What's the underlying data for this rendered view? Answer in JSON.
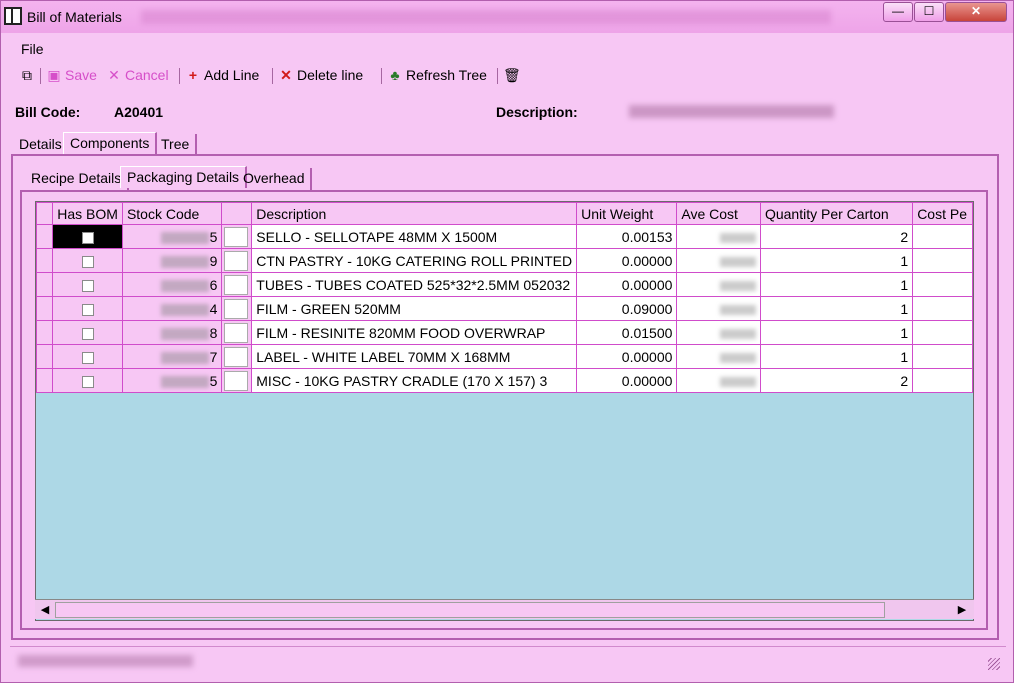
{
  "window": {
    "title": "Bill of Materials",
    "controls": {
      "minimize": "—",
      "maximize": "☐",
      "close": "✕"
    }
  },
  "menu": {
    "file": "File"
  },
  "toolbar": {
    "save": "Save",
    "cancel": "Cancel",
    "add_line": "Add Line",
    "delete_line": "Delete line",
    "refresh_tree": "Refresh Tree",
    "icons": {
      "copy": "copy-icon",
      "save": "save-icon",
      "cancel": "cancel-icon",
      "add": "plus-icon",
      "delete": "x-icon",
      "refresh": "tree-icon",
      "trash": "trash-icon"
    }
  },
  "header": {
    "bill_code_label": "Bill Code:",
    "bill_code_value": "A20401",
    "description_label": "Description:"
  },
  "tabs": {
    "outer": [
      "Details",
      "Components",
      "Tree"
    ],
    "outer_active": "Components",
    "inner": [
      "Recipe Details",
      "Packaging Details",
      "Overhead"
    ],
    "inner_active": "Packaging Details"
  },
  "grid": {
    "columns": [
      "Has BOM",
      "Stock Code",
      "",
      "Description",
      "Unit Weight",
      "Ave Cost",
      "Quantity Per Carton",
      "Cost Pe"
    ],
    "rows": [
      {
        "stock_code_tail": "5",
        "description": "SELLO - SELLOTAPE 48MM X 1500M",
        "unit_weight": "0.00153",
        "qty_per_carton": "2"
      },
      {
        "stock_code_tail": "9",
        "description": "CTN PASTRY - 10KG CATERING ROLL PRINTED",
        "unit_weight": "0.00000",
        "qty_per_carton": "1"
      },
      {
        "stock_code_tail": "6",
        "description": "TUBES - TUBES COATED 525*32*2.5MM 052032",
        "unit_weight": "0.00000",
        "qty_per_carton": "1"
      },
      {
        "stock_code_tail": "4",
        "description": "FILM - GREEN 520MM",
        "unit_weight": "0.09000",
        "qty_per_carton": "1"
      },
      {
        "stock_code_tail": "8",
        "description": "FILM - RESINITE 820MM FOOD OVERWRAP",
        "unit_weight": "0.01500",
        "qty_per_carton": "1"
      },
      {
        "stock_code_tail": "7",
        "description": "LABEL - WHITE LABEL 70MM X 168MM",
        "unit_weight": "0.00000",
        "qty_per_carton": "1"
      },
      {
        "stock_code_tail": "5",
        "description": "MISC - 10KG PASTRY CRADLE (170 X 157) 3",
        "unit_weight": "0.00000",
        "qty_per_carton": "2"
      }
    ]
  },
  "scrollbar": {
    "left_arrow": "◀",
    "right_arrow": "▶"
  }
}
